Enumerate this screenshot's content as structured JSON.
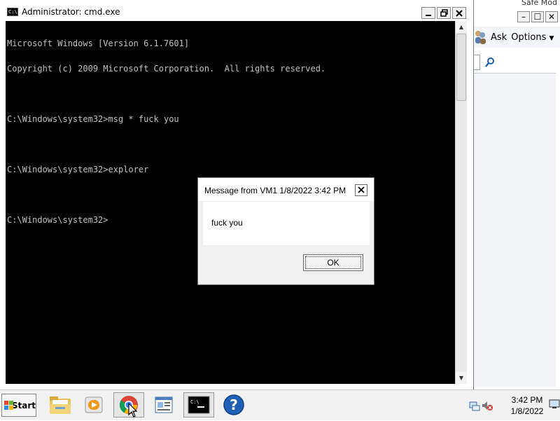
{
  "help_window": {
    "title_fragment": "Safe Mod",
    "toolbar": {
      "ask_label": "Ask",
      "options_label": "Options"
    }
  },
  "cmd_window": {
    "title": "Administrator: cmd.exe",
    "icon_label": "C:\\",
    "console_lines": [
      "Microsoft Windows [Version 6.1.7601]",
      "Copyright (c) 2009 Microsoft Corporation.  All rights reserved.",
      "",
      "C:\\Windows\\system32>msg * fuck you",
      "",
      "C:\\Windows\\system32>explorer",
      "",
      "C:\\Windows\\system32>"
    ]
  },
  "dialog": {
    "title": "Message from VM1 1/8/2022 3:42 PM",
    "message": "fuck you",
    "ok_label": "OK"
  },
  "taskbar": {
    "start_label": "Start",
    "pinned": [
      "folder-icon",
      "media-player-icon",
      "chrome-icon",
      "control-panel-icon",
      "cmd-icon",
      "help-icon"
    ],
    "clock": {
      "time": "3:42 PM",
      "date": "1/8/2022"
    }
  },
  "colors": {
    "console_bg": "#000000",
    "console_fg": "#c0c0c0",
    "taskbar_bg": "#f1f1f1",
    "help_blue": "#1f5fb5"
  }
}
